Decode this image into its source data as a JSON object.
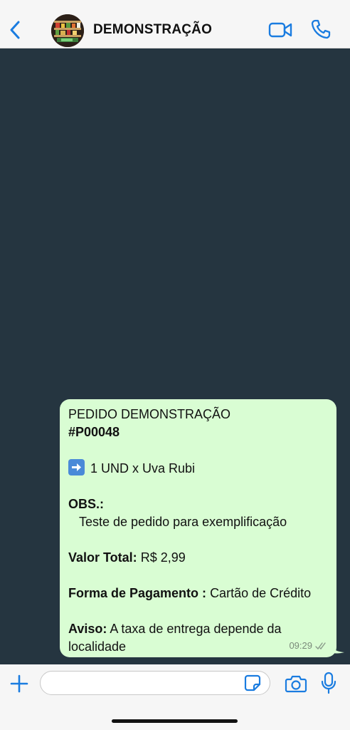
{
  "header": {
    "back_icon": "chevron-left-icon",
    "contact_name": "DEMONSTRAÇÃO",
    "video_icon": "video-camera-icon",
    "call_icon": "phone-icon"
  },
  "message": {
    "title_line1": "PEDIDO DEMONSTRAÇÃO",
    "title_line2": "#P00048",
    "item_emoji": "right-arrow-emoji",
    "item_text": "1 UND x Uva Rubi",
    "obs_label": "OBS.:",
    "obs_text": "Teste de pedido para exemplificação",
    "total_label": "Valor Total:",
    "total_value": "R$ 2,99",
    "payment_label": "Forma de Pagamento :",
    "payment_value": "Cartão de Crédito",
    "notice_label": "Aviso:",
    "notice_text_line1": "A taxa de entrega depende da",
    "notice_text_line2": "localidade",
    "time": "09:29",
    "status_icon": "double-check-icon"
  },
  "input_bar": {
    "plus_icon": "plus-icon",
    "message_value": "",
    "sticker_icon": "sticker-icon",
    "camera_icon": "camera-icon",
    "mic_icon": "microphone-icon"
  },
  "colors": {
    "accent": "#1a7ce0",
    "chat_background": "#253540",
    "bubble": "#d9fdd3",
    "bar_background": "#f6f6f6"
  }
}
